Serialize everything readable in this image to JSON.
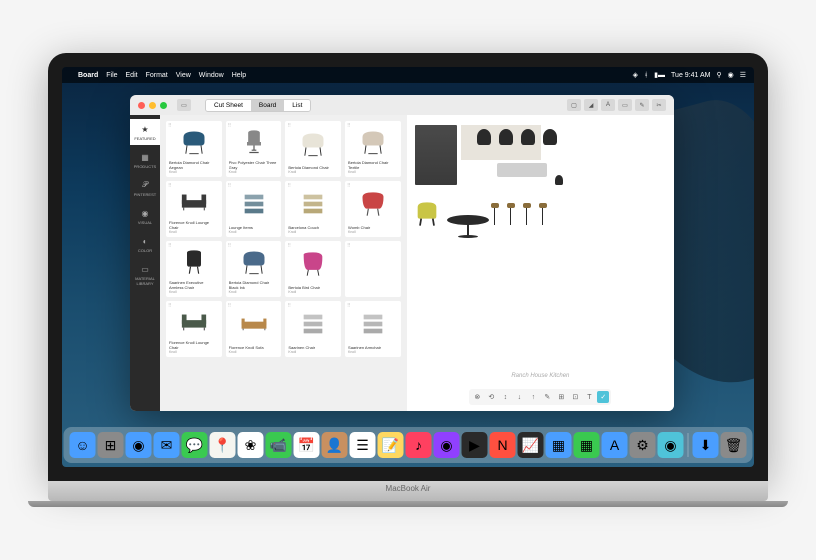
{
  "menubar": {
    "app_name": "Board",
    "items": [
      "File",
      "Edit",
      "Format",
      "View",
      "Window",
      "Help"
    ],
    "time": "Tue 9:41 AM"
  },
  "window": {
    "tabs": [
      "Cut Sheet",
      "Board",
      "List"
    ],
    "active_tab": 1
  },
  "sidebar": {
    "items": [
      {
        "icon": "★",
        "label": "FEATURED"
      },
      {
        "icon": "▦",
        "label": "PRODUCTS"
      },
      {
        "icon": "𝒫",
        "label": "PINTEREST"
      },
      {
        "icon": "◉",
        "label": "VISUAL"
      },
      {
        "icon": "◐",
        "label": "COLOR"
      },
      {
        "icon": "▭",
        "label": "MATERIAL LIBRARY"
      }
    ]
  },
  "catalog": {
    "products": [
      {
        "name": "Bertoia Diamond Chair Aegean",
        "brand": "Knoll",
        "color": "#2a5a7a",
        "type": "diamond"
      },
      {
        "name": "Pivo Polyester Chair Three Gray",
        "brand": "Knoll",
        "color": "#888",
        "type": "office"
      },
      {
        "name": "Bertoia Diamond Chair",
        "brand": "Knoll",
        "color": "#e8e4d8",
        "type": "diamond"
      },
      {
        "name": "Bertoia Diamond Chair Textile",
        "brand": "Knoll",
        "color": "#d4c8b8",
        "type": "diamond"
      },
      {
        "name": "Florence Knoll Lounge Chair",
        "brand": "Knoll",
        "color": "#3a3a3a",
        "type": "lounge"
      },
      {
        "name": "Lounge Items",
        "brand": "Knoll",
        "color": "#5a7a8a",
        "type": "stack"
      },
      {
        "name": "Barcelona Couch",
        "brand": "Knoll",
        "color": "#b8a878",
        "type": "stack"
      },
      {
        "name": "Womb Chair",
        "brand": "Knoll",
        "color": "#c94545",
        "type": "womb"
      },
      {
        "name": "Saarinen Executive Armless Chair",
        "brand": "Knoll",
        "color": "#2a2a2a",
        "type": "exec"
      },
      {
        "name": "Bertoia Diamond Chair Black Ink",
        "brand": "Knoll",
        "color": "#4a6a8a",
        "type": "diamond"
      },
      {
        "name": "Bertoia Bird Chair",
        "brand": "Knoll",
        "color": "#c9458a",
        "type": "bird"
      },
      {
        "name": "",
        "brand": "",
        "color": "#fff",
        "type": "empty"
      },
      {
        "name": "Florence Knoll Lounge Chair",
        "brand": "Knoll",
        "color": "#4a5a4a",
        "type": "lounge"
      },
      {
        "name": "Florence Knoll Sofa",
        "brand": "Knoll",
        "color": "#b8884a",
        "type": "sofa"
      },
      {
        "name": "Saarinen Chair",
        "brand": "Knoll",
        "color": "#aaa",
        "type": "stack"
      },
      {
        "name": "Saarinen Armchair",
        "brand": "Knoll",
        "color": "#aaa",
        "type": "stack"
      }
    ]
  },
  "board": {
    "title": "Ranch House Kitchen",
    "tools": [
      "⊗",
      "⟲",
      "↕",
      "↓",
      "↑",
      "✎",
      "⊞",
      "⊡",
      "T",
      "✓"
    ]
  },
  "dock": {
    "apps": [
      {
        "name": "finder",
        "color": "#4a9eff",
        "glyph": "☺"
      },
      {
        "name": "launchpad",
        "color": "#8a8a8a",
        "glyph": "⊞"
      },
      {
        "name": "safari",
        "color": "#4a9eff",
        "glyph": "◉"
      },
      {
        "name": "mail",
        "color": "#4aa0ff",
        "glyph": "✉"
      },
      {
        "name": "messages",
        "color": "#3ac950",
        "glyph": "💬"
      },
      {
        "name": "maps",
        "color": "#f5f5f0",
        "glyph": "📍"
      },
      {
        "name": "photos",
        "color": "#fff",
        "glyph": "❀"
      },
      {
        "name": "facetime",
        "color": "#3ac950",
        "glyph": "📹"
      },
      {
        "name": "calendar",
        "color": "#fff",
        "glyph": "📅"
      },
      {
        "name": "contacts",
        "color": "#c89060",
        "glyph": "👤"
      },
      {
        "name": "reminders",
        "color": "#fff",
        "glyph": "☰"
      },
      {
        "name": "notes",
        "color": "#ffd860",
        "glyph": "📝"
      },
      {
        "name": "music",
        "color": "#ff4060",
        "glyph": "♪"
      },
      {
        "name": "podcasts",
        "color": "#9040ff",
        "glyph": "◉"
      },
      {
        "name": "tv",
        "color": "#2a2a2a",
        "glyph": "▶"
      },
      {
        "name": "news",
        "color": "#ff5040",
        "glyph": "N"
      },
      {
        "name": "stocks",
        "color": "#2a2a2a",
        "glyph": "📈"
      },
      {
        "name": "keynote",
        "color": "#4a9eff",
        "glyph": "▦"
      },
      {
        "name": "numbers",
        "color": "#3ac950",
        "glyph": "▦"
      },
      {
        "name": "appstore",
        "color": "#4a9eff",
        "glyph": "A"
      },
      {
        "name": "preferences",
        "color": "#8a8a8a",
        "glyph": "⚙"
      },
      {
        "name": "board-app",
        "color": "#4fc3d9",
        "glyph": "◉"
      },
      {
        "name": "downloads",
        "color": "#4a9eff",
        "glyph": "⬇"
      },
      {
        "name": "trash",
        "color": "#8a8a8a",
        "glyph": "🗑"
      }
    ]
  },
  "laptop_model": "MacBook Air"
}
